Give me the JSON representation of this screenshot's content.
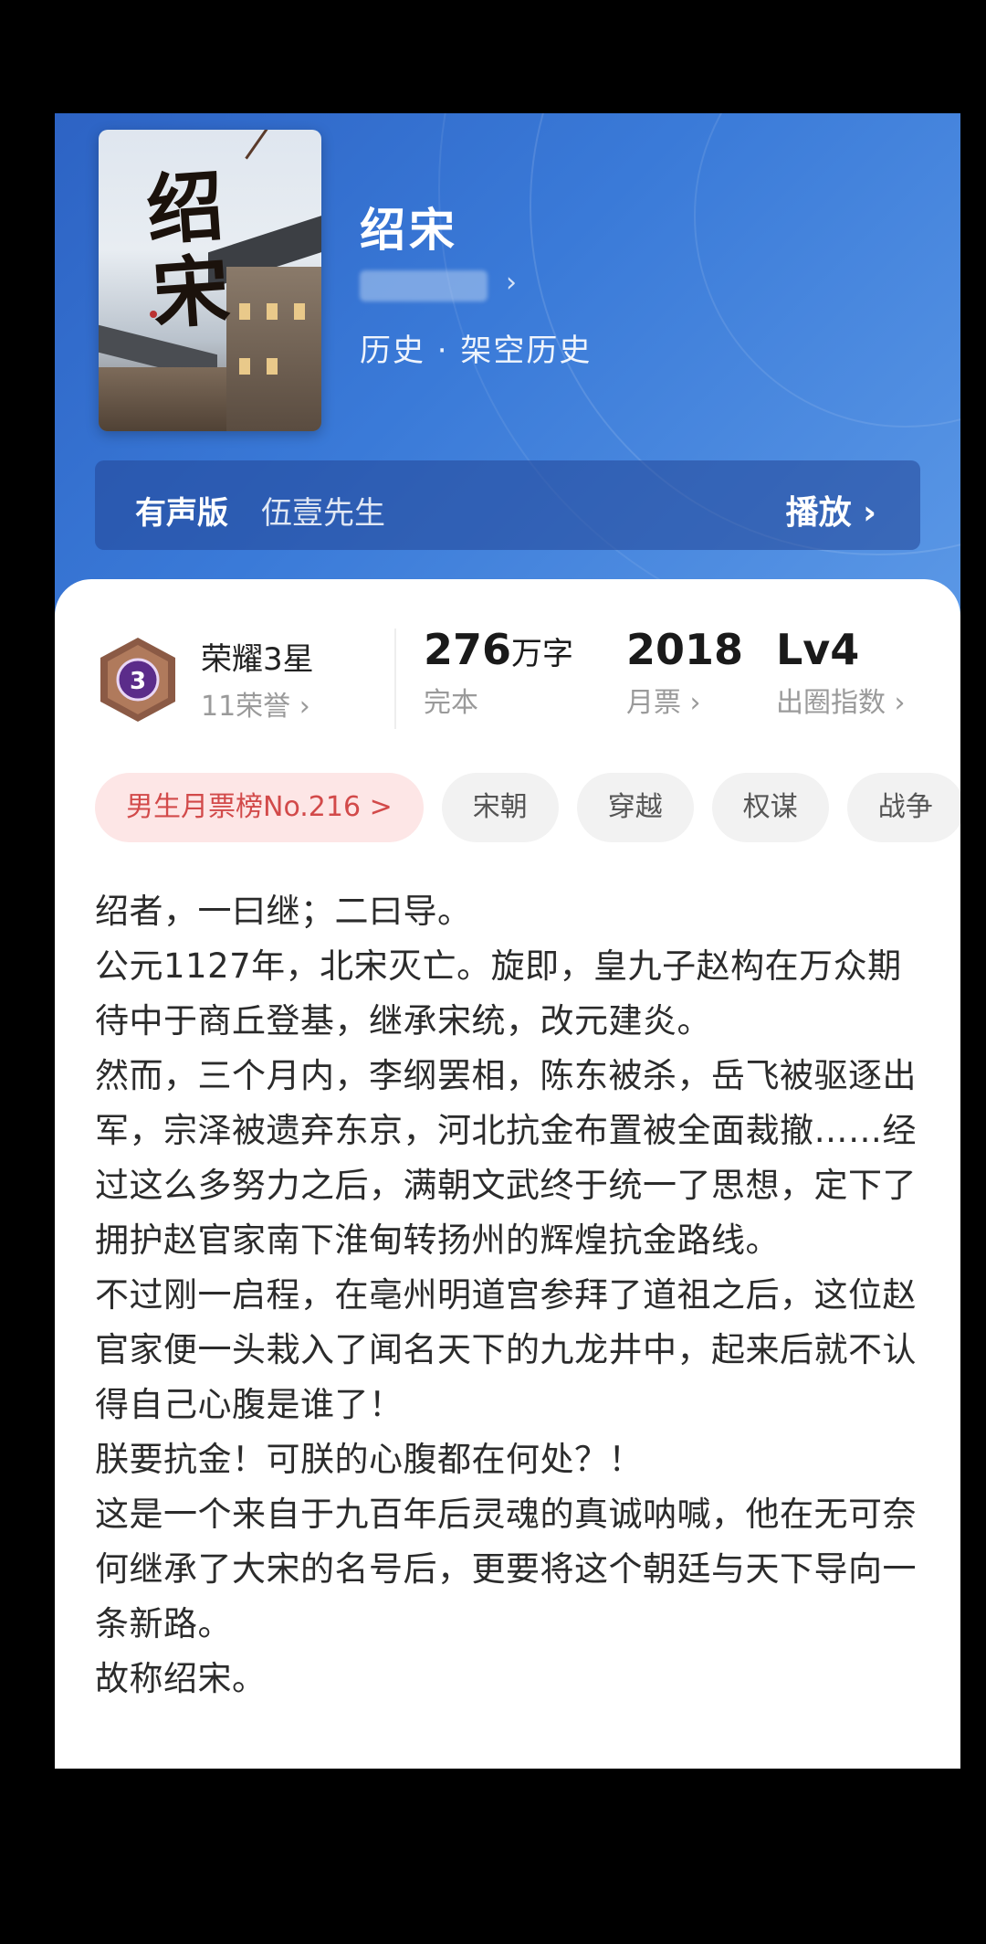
{
  "book": {
    "title": "绍宋",
    "genre": "历史 · 架空历史",
    "cover_art_text": "绍宋"
  },
  "audio": {
    "label": "有声版",
    "narrator": "伍壹先生",
    "play_label": "播放 ›"
  },
  "stats": {
    "honor_title": "荣耀3星",
    "honor_sub": "11荣誉 ›",
    "honor_badge_number": "3",
    "word_count": "276",
    "word_unit": "万字",
    "word_label": "完本",
    "monthly_votes": "2018",
    "monthly_label": "月票 ›",
    "level": "Lv4",
    "level_label": "出圈指数 ›"
  },
  "tags": [
    {
      "label": "男生月票榜No.216 >"
    },
    {
      "label": "宋朝"
    },
    {
      "label": "穿越"
    },
    {
      "label": "权谋"
    },
    {
      "label": "战争"
    }
  ],
  "description": [
    "绍者，一曰继；二曰导。",
    "公元1127年，北宋灭亡。旋即，皇九子赵构在万众期待中于商丘登基，继承宋统，改元建炎。",
    "然而，三个月内，李纲罢相，陈东被杀，岳飞被驱逐出军，宗泽被遗弃东京，河北抗金布置被全面裁撤……经过这么多努力之后，满朝文武终于统一了思想，定下了拥护赵官家南下淮甸转扬州的辉煌抗金路线。",
    "不过刚一启程，在亳州明道宫参拜了道祖之后，这位赵官家便一头栽入了闻名天下的九龙井中，起来后就不认得自己心腹是谁了！",
    "朕要抗金！可朕的心腹都在何处？！",
    "这是一个来自于九百年后灵魂的真诚呐喊，他在无可奈何继承了大宋的名号后，更要将这个朝廷与天下导向一条新路。",
    "故称绍宋。"
  ],
  "colors": {
    "hero_blue": "#3a7ad8",
    "rank_tag_bg": "#fde6e6",
    "rank_tag_text": "#d24a4a",
    "badge_purple": "#5b2c8a"
  }
}
